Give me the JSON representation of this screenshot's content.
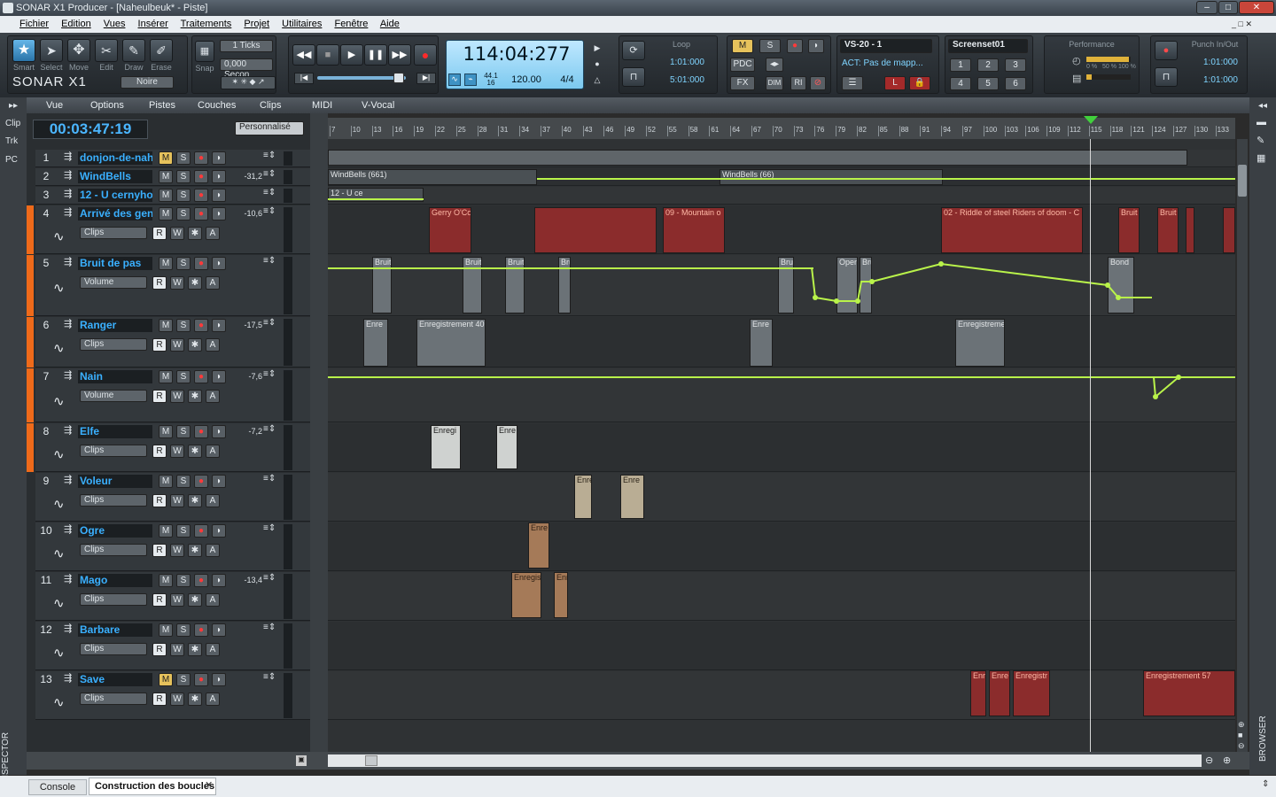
{
  "title_bar": {
    "text": "SONAR X1 Producer - [Naheulbeuk* - Piste]",
    "buttons": [
      "–",
      "□",
      "✕"
    ]
  },
  "menu": [
    "Fichier",
    "Edition",
    "Vues",
    "Insérer",
    "Traitements",
    "Projet",
    "Utilitaires",
    "Fenêtre",
    "Aide"
  ],
  "tools": {
    "labels": [
      "Smart",
      "Select",
      "Move",
      "Edit",
      "Draw",
      "Erase"
    ],
    "logo": "SONAR X1",
    "snap_label": "Snap",
    "ticks": "1 Ticks",
    "seconds": "0,000 Secon",
    "noire": "Noire"
  },
  "transport": {
    "time": "114:04:277",
    "sig_top": "44.1",
    "sig_bottom": "16",
    "tempo": "120.00",
    "meter": "4/4"
  },
  "loop": {
    "label": "Loop",
    "start": "1:01:000",
    "end": "5:01:000"
  },
  "mix": {
    "m": "M",
    "s": "S",
    "pdc": "PDC",
    "fx": "FX",
    "dim": "DIM",
    "ri": "RI"
  },
  "act": {
    "device": "VS-20 - 1",
    "status": "ACT: Pas de mapp..."
  },
  "screenset": {
    "label": "Screenset01",
    "numbers": [
      "1",
      "2",
      "3",
      "4",
      "5",
      "6"
    ]
  },
  "performance": {
    "label": "Performance",
    "a": "0 %",
    "b": "50 %",
    "c": "100 %"
  },
  "punch": {
    "label": "Punch In/Out",
    "start": "1:01:000",
    "end": "1:01:000"
  },
  "track_menu": [
    "Vue",
    "Options",
    "Pistes",
    "Couches",
    "Clips",
    "MIDI",
    "V-Vocal"
  ],
  "now_time": "00:03:47:19",
  "preset": "Personnalisé",
  "left_tabs": [
    "Clip",
    "Trk",
    "PC"
  ],
  "inspector": "INSPECTOR",
  "browser": "BROWSER",
  "ruler_ticks": [
    "7",
    "10",
    "13",
    "16",
    "19",
    "22",
    "25",
    "28",
    "31",
    "34",
    "37",
    "40",
    "43",
    "46",
    "49",
    "52",
    "55",
    "58",
    "61",
    "64",
    "67",
    "70",
    "73",
    "76",
    "79",
    "82",
    "85",
    "88",
    "91",
    "94",
    "97",
    "100",
    "103",
    "106",
    "109",
    "112",
    "115",
    "118",
    "121",
    "124",
    "127",
    "130",
    "133"
  ],
  "tracks": [
    {
      "n": "1",
      "name": "donjon-de-nah",
      "m": "M",
      "s": "S",
      "vol": "",
      "combo": "",
      "mActive": true
    },
    {
      "n": "2",
      "name": "WindBells",
      "m": "M",
      "s": "S",
      "vol": "-31,2",
      "combo": "",
      "mActive": false
    },
    {
      "n": "3",
      "name": "12 - U cernyho",
      "m": "M",
      "s": "S",
      "vol": "",
      "combo": "",
      "mActive": false
    },
    {
      "n": "4",
      "name": "Arrivé des gen",
      "m": "M",
      "s": "S",
      "vol": "-10,6",
      "combo": "Clips",
      "mActive": false
    },
    {
      "n": "5",
      "name": "Bruit de pas",
      "m": "M",
      "s": "S",
      "vol": "",
      "combo": "Volume",
      "mActive": false
    },
    {
      "n": "6",
      "name": "Ranger",
      "m": "M",
      "s": "S",
      "vol": "-17,5",
      "combo": "Clips",
      "mActive": false
    },
    {
      "n": "7",
      "name": "Nain",
      "m": "M",
      "s": "S",
      "vol": "-7,6",
      "combo": "Volume",
      "mActive": false
    },
    {
      "n": "8",
      "name": "Elfe",
      "m": "M",
      "s": "S",
      "vol": "-7,2",
      "combo": "Clips",
      "mActive": false
    },
    {
      "n": "9",
      "name": "Voleur",
      "m": "M",
      "s": "S",
      "vol": "",
      "combo": "Clips",
      "mActive": false
    },
    {
      "n": "10",
      "name": "Ogre",
      "m": "M",
      "s": "S",
      "vol": "",
      "combo": "Clips",
      "mActive": false
    },
    {
      "n": "11",
      "name": "Mago",
      "m": "M",
      "s": "S",
      "vol": "-13,4",
      "combo": "Clips",
      "mActive": false
    },
    {
      "n": "12",
      "name": "Barbare",
      "m": "M",
      "s": "S",
      "vol": "",
      "combo": "Clips",
      "mActive": false
    },
    {
      "n": "13",
      "name": "Save",
      "m": "M",
      "s": "S",
      "vol": "",
      "combo": "Clips",
      "mActive": true
    }
  ],
  "clips": {
    "c4a": "Gerry O'Co",
    "c4b": "09 - Mountain o",
    "c4c": "02 - Riddle of steel Riders of doom - C",
    "c4d": "Bruit",
    "c4e": "Bruit",
    "c5a": "Bruit",
    "c5b": "Bruit",
    "c5c": "Bruit",
    "c5d": "Bruit",
    "c5e": "Bruit",
    "c5f": "Open",
    "c5g": "Bruit",
    "c5h": "Bond",
    "c6a": "Enre",
    "c6b": "Enregistrement 40",
    "c6c": "Enre",
    "c6d": "Enregistreme",
    "c8a": "Enregi",
    "c8b": "Enre",
    "c9a": "Enre",
    "c9b": "Enre",
    "c10a": "Enre",
    "c11a": "Enregis",
    "c11b": "Enr",
    "c13a": "Enr",
    "c13b": "Enre",
    "c13c": "Enregistr",
    "c13d": "Enregistrement 57",
    "c2a": "WindBells (661)",
    "c2b": "WindBells (66)",
    "c3a": "12 - U ce"
  },
  "tabs": [
    "Console",
    "Construction des boucles"
  ]
}
